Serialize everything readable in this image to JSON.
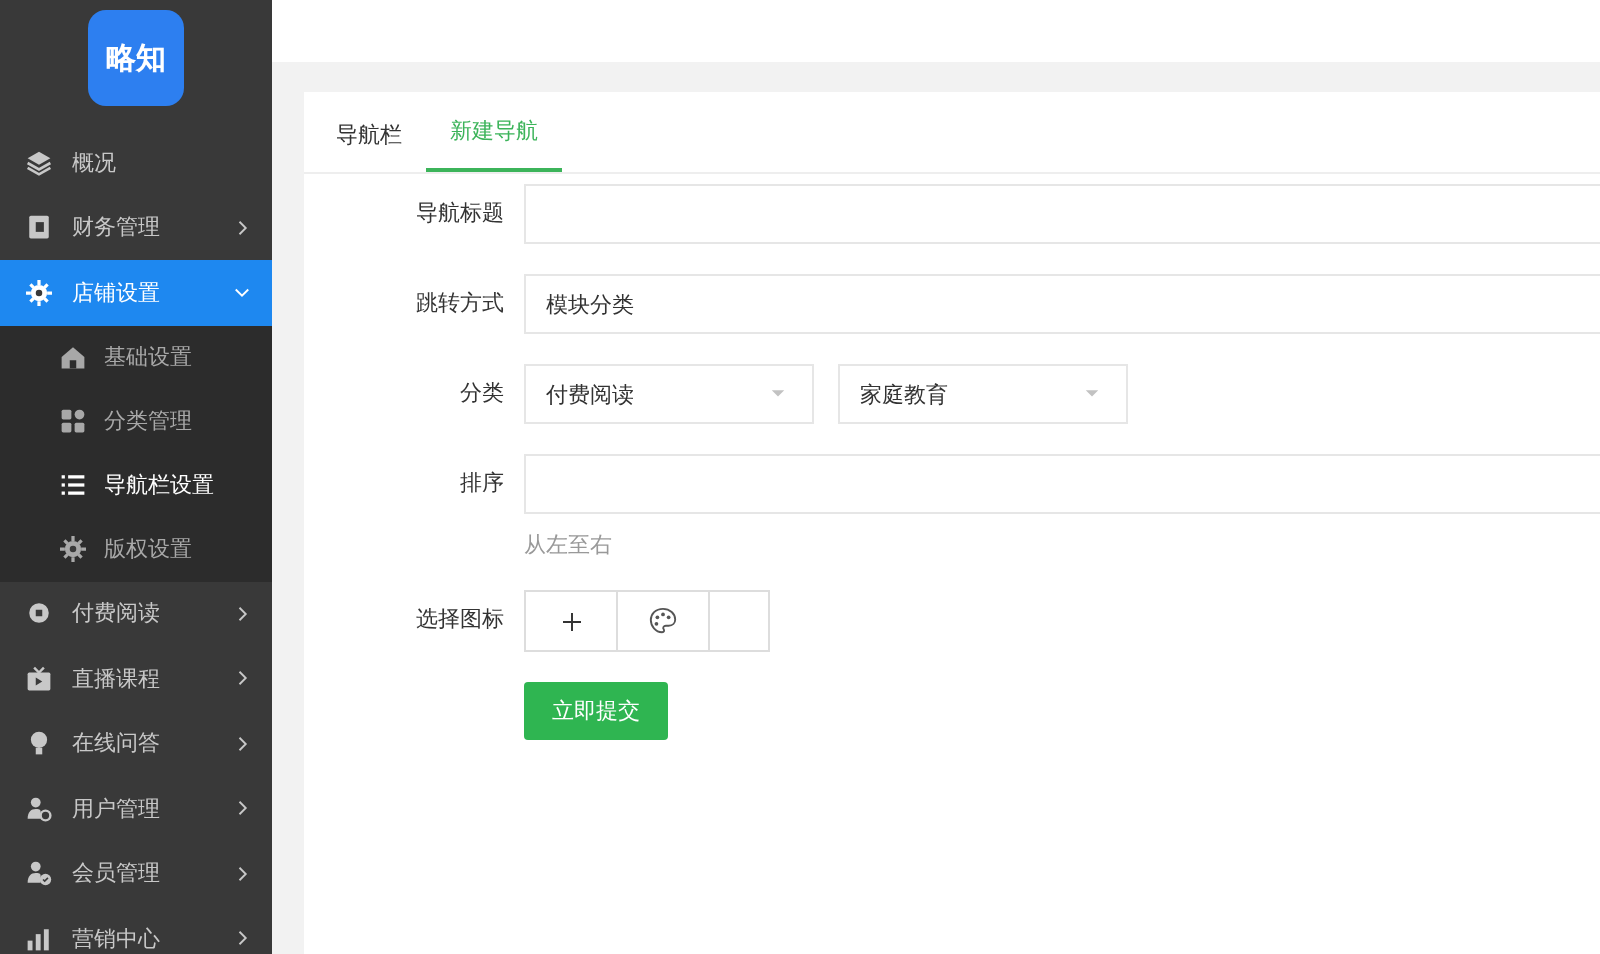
{
  "logo": {
    "text": "略知"
  },
  "sidebar": {
    "items": [
      {
        "label": "概况",
        "selected": false
      },
      {
        "label": "财务管理",
        "selected": false,
        "expanded": false
      },
      {
        "label": "店铺设置",
        "selected": true,
        "expanded": true,
        "children": [
          {
            "label": "基础设置",
            "selected": false
          },
          {
            "label": "分类管理",
            "selected": false
          },
          {
            "label": "导航栏设置",
            "selected": true
          },
          {
            "label": "版权设置",
            "selected": false
          }
        ]
      },
      {
        "label": "付费阅读",
        "selected": false,
        "expanded": false
      },
      {
        "label": "直播课程",
        "selected": false,
        "expanded": false
      },
      {
        "label": "在线问答",
        "selected": false,
        "expanded": false
      },
      {
        "label": "用户管理",
        "selected": false,
        "expanded": false
      },
      {
        "label": "会员管理",
        "selected": false,
        "expanded": false
      },
      {
        "label": "营销中心",
        "selected": false,
        "expanded": false
      }
    ]
  },
  "tabs": [
    {
      "label": "导航栏",
      "selected": false
    },
    {
      "label": "新建导航",
      "selected": true
    }
  ],
  "form": {
    "fields": [
      {
        "kind": "text",
        "label": "导航标题"
      },
      {
        "kind": "text",
        "label": "跳转方式",
        "value": "模块分类"
      },
      {
        "kind": "selects",
        "label": "分类",
        "options": [
          "付费阅读",
          "家庭教育"
        ]
      },
      {
        "kind": "text",
        "label": "排序",
        "hint": "从左至右"
      },
      {
        "kind": "icon-picker",
        "label": "选择图标"
      }
    ],
    "submit": "立即提交"
  }
}
